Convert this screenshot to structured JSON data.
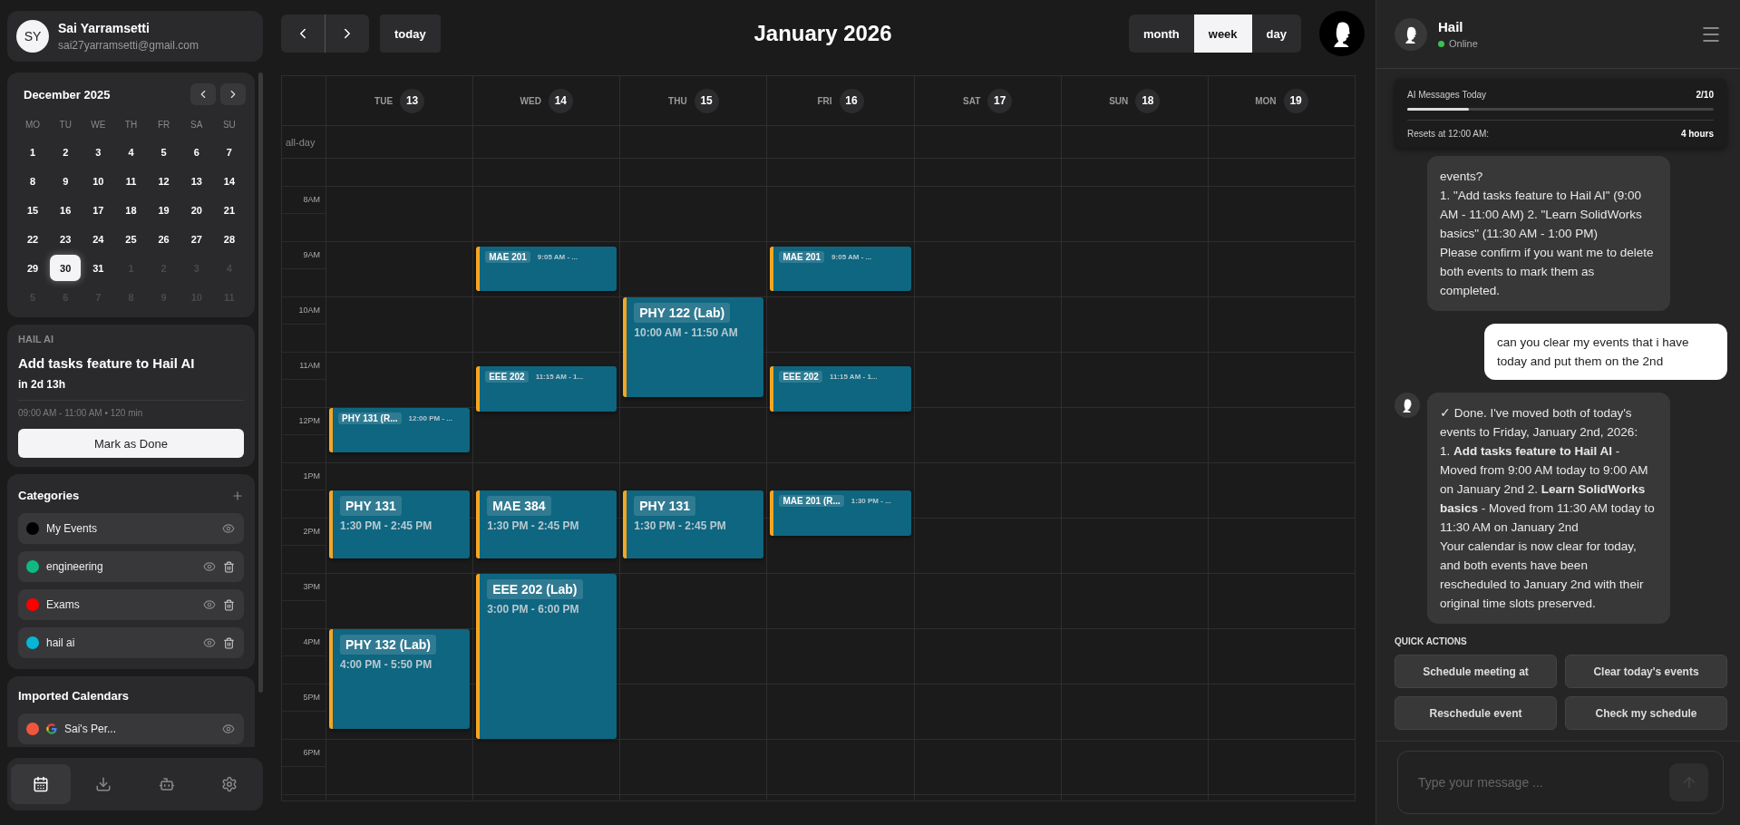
{
  "profile": {
    "initials": "SY",
    "name": "Sai Yarramsetti",
    "email": "sai27yarramsetti@gmail.com"
  },
  "mini_calendar": {
    "title": "December 2025",
    "weekdays": [
      "MO",
      "TU",
      "WE",
      "TH",
      "FR",
      "SA",
      "SU"
    ],
    "weeks": [
      {
        "days": [
          {
            "label": "1",
            "outside": false,
            "selected": false
          },
          {
            "label": "2",
            "outside": false,
            "selected": false
          },
          {
            "label": "3",
            "outside": false,
            "selected": false
          },
          {
            "label": "4",
            "outside": false,
            "selected": false
          },
          {
            "label": "5",
            "outside": false,
            "selected": false
          },
          {
            "label": "6",
            "outside": false,
            "selected": false
          },
          {
            "label": "7",
            "outside": false,
            "selected": false
          }
        ]
      },
      {
        "days": [
          {
            "label": "8",
            "outside": false,
            "selected": false
          },
          {
            "label": "9",
            "outside": false,
            "selected": false
          },
          {
            "label": "10",
            "outside": false,
            "selected": false
          },
          {
            "label": "11",
            "outside": false,
            "selected": false
          },
          {
            "label": "12",
            "outside": false,
            "selected": false
          },
          {
            "label": "13",
            "outside": false,
            "selected": false
          },
          {
            "label": "14",
            "outside": false,
            "selected": false
          }
        ]
      },
      {
        "days": [
          {
            "label": "15",
            "outside": false,
            "selected": false
          },
          {
            "label": "16",
            "outside": false,
            "selected": false
          },
          {
            "label": "17",
            "outside": false,
            "selected": false
          },
          {
            "label": "18",
            "outside": false,
            "selected": false
          },
          {
            "label": "19",
            "outside": false,
            "selected": false
          },
          {
            "label": "20",
            "outside": false,
            "selected": false
          },
          {
            "label": "21",
            "outside": false,
            "selected": false
          }
        ]
      },
      {
        "days": [
          {
            "label": "22",
            "outside": false,
            "selected": false
          },
          {
            "label": "23",
            "outside": false,
            "selected": false
          },
          {
            "label": "24",
            "outside": false,
            "selected": false
          },
          {
            "label": "25",
            "outside": false,
            "selected": false
          },
          {
            "label": "26",
            "outside": false,
            "selected": false
          },
          {
            "label": "27",
            "outside": false,
            "selected": false
          },
          {
            "label": "28",
            "outside": false,
            "selected": false
          }
        ]
      },
      {
        "days": [
          {
            "label": "29",
            "outside": false,
            "selected": false
          },
          {
            "label": "30",
            "outside": false,
            "selected": true
          },
          {
            "label": "31",
            "outside": false,
            "selected": false
          },
          {
            "label": "1",
            "outside": true,
            "selected": false
          },
          {
            "label": "2",
            "outside": true,
            "selected": false
          },
          {
            "label": "3",
            "outside": true,
            "selected": false
          },
          {
            "label": "4",
            "outside": true,
            "selected": false
          }
        ]
      },
      {
        "days": [
          {
            "label": "5",
            "outside": true,
            "selected": false
          },
          {
            "label": "6",
            "outside": true,
            "selected": false
          },
          {
            "label": "7",
            "outside": true,
            "selected": false
          },
          {
            "label": "8",
            "outside": true,
            "selected": false
          },
          {
            "label": "9",
            "outside": true,
            "selected": false
          },
          {
            "label": "10",
            "outside": true,
            "selected": false
          },
          {
            "label": "11",
            "outside": true,
            "selected": false
          }
        ]
      }
    ]
  },
  "upcoming": {
    "label": "HAIL AI",
    "title": "Add tasks feature to Hail AI",
    "countdown": "in 2d 13h",
    "details": "09:00 AM - 11:00 AM • 120 min",
    "button": "Mark as Done"
  },
  "categories": {
    "title": "Categories",
    "items": [
      {
        "name": "My Events",
        "color": "#000000",
        "deletable": false
      },
      {
        "name": "engineering",
        "color": "#10b981",
        "deletable": true
      },
      {
        "name": "Exams",
        "color": "#ff0000",
        "deletable": true
      },
      {
        "name": "hail ai",
        "color": "#06b6d4",
        "deletable": true
      }
    ]
  },
  "imported": {
    "title": "Imported Calendars",
    "items": [
      {
        "name": "Sai's Per...",
        "color": "#f0563d",
        "kind": "google"
      }
    ]
  },
  "nav": [
    {
      "kind": "calendar",
      "selected": true
    },
    {
      "kind": "download",
      "selected": false
    },
    {
      "kind": "robot",
      "selected": false
    },
    {
      "kind": "settings",
      "selected": false
    }
  ],
  "toolbar": {
    "today": "today",
    "title": "January 2026",
    "views": [
      {
        "label": "month",
        "selected": false
      },
      {
        "label": "week",
        "selected": true
      },
      {
        "label": "day",
        "selected": false
      }
    ]
  },
  "week": {
    "all_day_label": "all-day",
    "times": [
      "8AM",
      "9AM",
      "10AM",
      "11AM",
      "12PM",
      "1PM",
      "2PM",
      "3PM",
      "4PM",
      "5PM",
      "6PM"
    ],
    "days": [
      {
        "weekday": "TUE",
        "date": "13",
        "events": [
          {
            "kind": "compact",
            "title": "PHY 131 (R...",
            "time": "12:00 PM - ..."
          },
          {
            "kind": "full",
            "title": "PHY 131",
            "time": "1:30 PM - 2:45 PM"
          },
          {
            "kind": "full",
            "title": "PHY 132 (Lab)",
            "time": "4:00 PM - 5:50 PM"
          }
        ]
      },
      {
        "weekday": "WED",
        "date": "14",
        "events": [
          {
            "kind": "compact",
            "title": "MAE 201",
            "time": "9:05 AM - ..."
          },
          {
            "kind": "compact",
            "title": "EEE 202",
            "time": "11:15 AM - 1..."
          },
          {
            "kind": "full",
            "title": "MAE 384",
            "time": "1:30 PM - 2:45 PM"
          },
          {
            "kind": "full",
            "title": "EEE 202 (Lab)",
            "time": "3:00 PM - 6:00 PM"
          }
        ]
      },
      {
        "weekday": "THU",
        "date": "15",
        "events": [
          {
            "kind": "full",
            "title": "PHY 122 (Lab)",
            "time": "10:00 AM - 11:50 AM"
          },
          {
            "kind": "full",
            "title": "PHY 131",
            "time": "1:30 PM - 2:45 PM"
          }
        ]
      },
      {
        "weekday": "FRI",
        "date": "16",
        "events": [
          {
            "kind": "compact",
            "title": "MAE 201",
            "time": "9:05 AM - ..."
          },
          {
            "kind": "compact",
            "title": "EEE 202",
            "time": "11:15 AM - 1..."
          },
          {
            "kind": "compact",
            "title": "MAE 201 (R...",
            "time": "1:30 PM - ..."
          }
        ]
      },
      {
        "weekday": "SAT",
        "date": "17"
      },
      {
        "weekday": "SUN",
        "date": "18"
      },
      {
        "weekday": "MON",
        "date": "19"
      }
    ]
  },
  "chat": {
    "name": "Hail",
    "status": "Online",
    "online": true,
    "usage": {
      "label": "AI Messages Today",
      "count": "2/10",
      "level": 0.2,
      "reset_label": "Resets at 12:00 AM:",
      "reset_value": "4 hours"
    },
    "messages": [
      {
        "kind": "assistant",
        "avatar": false,
        "text": "events?\n1. \"Add tasks feature to Hail AI\" (9:00 AM - 11:00 AM) 2. \"Learn SolidWorks basics\" (11:30 AM - 1:00 PM)\nPlease confirm if you want me to delete both events to mark them as completed."
      },
      {
        "kind": "user",
        "text": "can you clear my events that i have today and put them on the 2nd"
      },
      {
        "kind": "assistant",
        "avatar": true,
        "text": "✓ Done. I've moved both of today's events to Friday, January 2nd, 2026:\n1. **Add tasks feature to Hail AI** - Moved from 9:00 AM today to 9:00 AM on January 2nd 2. **Learn SolidWorks basics** - Moved from 11:30 AM today to 11:30 AM on January 2nd\nYour calendar is now clear for today, and both events have been rescheduled to January 2nd with their original time slots preserved."
      }
    ],
    "quick_actions": {
      "title": "QUICK ACTIONS",
      "buttons": [
        "Schedule meeting at",
        "Clear today's events",
        "Reschedule event",
        "Check my schedule"
      ]
    },
    "input": {
      "placeholder": "Type your message ..."
    }
  }
}
